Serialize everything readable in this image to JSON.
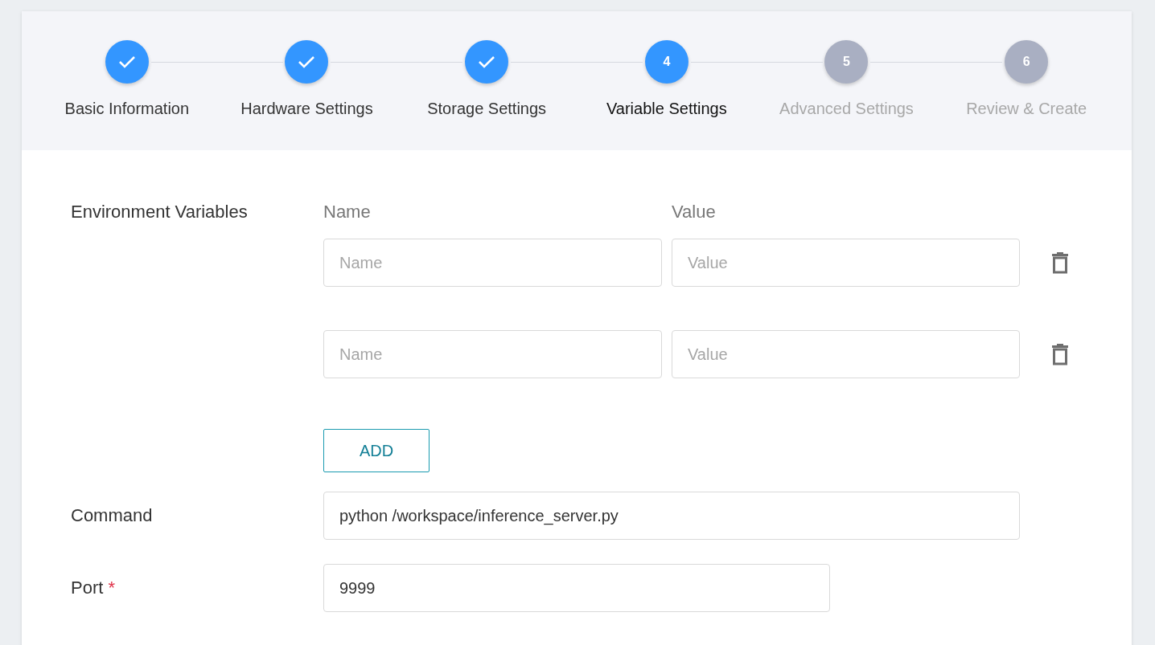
{
  "stepper": [
    {
      "label": "Basic Information",
      "kind": "done"
    },
    {
      "label": "Hardware Settings",
      "kind": "done"
    },
    {
      "label": "Storage Settings",
      "kind": "done"
    },
    {
      "label": "Variable Settings",
      "kind": "active",
      "number": "4"
    },
    {
      "label": "Advanced Settings",
      "kind": "pending",
      "number": "5"
    },
    {
      "label": "Review & Create",
      "kind": "pending",
      "number": "6"
    }
  ],
  "env": {
    "label": "Environment Variables",
    "name_header": "Name",
    "value_header": "Value",
    "rows": [
      {
        "name_placeholder": "Name",
        "value_placeholder": "Value"
      },
      {
        "name_placeholder": "Name",
        "value_placeholder": "Value"
      }
    ],
    "add_button": "ADD"
  },
  "command": {
    "label": "Command",
    "value": "python /workspace/inference_server.py"
  },
  "port": {
    "label": "Port",
    "required_mark": "*",
    "value": "9999"
  }
}
